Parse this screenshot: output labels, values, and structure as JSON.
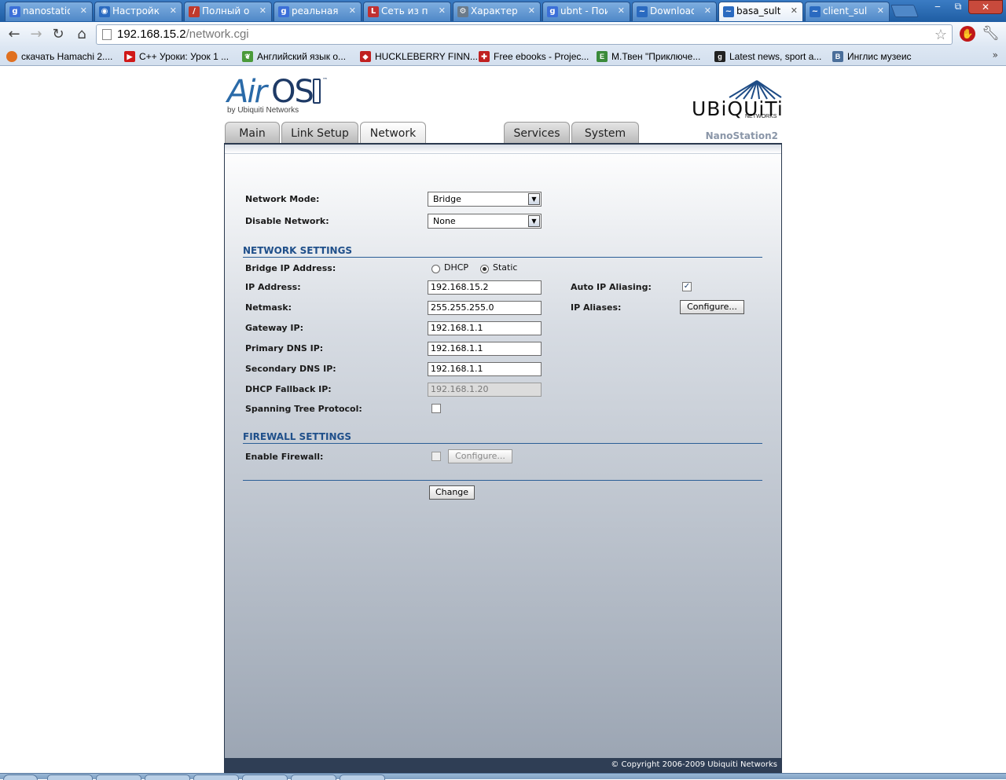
{
  "browser": {
    "tabs": [
      {
        "title": "nanostatio",
        "icon": "google-icon",
        "color": "#3b6fd8",
        "glyph": "g"
      },
      {
        "title": "Настройка",
        "icon": "globe-icon",
        "color": "#2a6ac0",
        "glyph": "◉"
      },
      {
        "title": "Полный о",
        "icon": "pen-icon",
        "color": "#c0392b",
        "glyph": "/"
      },
      {
        "title": "реальная",
        "icon": "google-icon",
        "color": "#3b6fd8",
        "glyph": "g"
      },
      {
        "title": "Сеть из па",
        "icon": "lan-icon",
        "color": "#c03030",
        "glyph": "L"
      },
      {
        "title": "Характери",
        "icon": "wrench-icon",
        "color": "#6a7a8a",
        "glyph": "⚙"
      },
      {
        "title": "ubnt - Пои",
        "icon": "google-icon",
        "color": "#3b6fd8",
        "glyph": "g"
      },
      {
        "title": "Download",
        "icon": "ubnt-icon",
        "color": "#2a6ac0",
        "glyph": "~"
      },
      {
        "title": "basa_sultar",
        "icon": "ubnt-icon",
        "color": "#2a6ac0",
        "glyph": "~"
      },
      {
        "title": "client_sulta",
        "icon": "ubnt-icon",
        "color": "#2a6ac0",
        "glyph": "~"
      }
    ],
    "window_controls": {
      "minimize": "‒",
      "maximize": "⧉",
      "close": "✕"
    },
    "nav": {
      "back": "←",
      "forward": "→",
      "reload": "↻",
      "home": "⌂"
    },
    "address": {
      "host": "192.168.15.2",
      "path": "/network.cgi"
    },
    "bookmarks": [
      {
        "label": "скачать Hamachi 2....",
        "icon": "firefox-icon",
        "color": "#e07020"
      },
      {
        "label": "C++ Уроки: Урок 1 ...",
        "icon": "youtube-icon",
        "color": "#d01818"
      },
      {
        "label": "Английский язык о...",
        "icon": "leaf-icon",
        "color": "#4a9a3a"
      },
      {
        "label": "HUCKLEBERRY FINN...",
        "icon": "diamond-icon",
        "color": "#c02020"
      },
      {
        "label": "Free ebooks - Projec...",
        "icon": "gutenberg-icon",
        "color": "#c02020"
      },
      {
        "label": "М.Твен \"Приключе...",
        "icon": "eng-icon",
        "color": "#3a8a3a"
      },
      {
        "label": "Latest news, sport a...",
        "icon": "g-icon",
        "color": "#222222"
      },
      {
        "label": "Инглис музеис",
        "icon": "vk-icon",
        "color": "#4a6e9a"
      }
    ],
    "bookmarks_more": "»"
  },
  "branding": {
    "air": "Air",
    "os": "OS",
    "tm": "™",
    "by": "by Ubiquiti Networks",
    "vendor": "UBiQUiTi",
    "vendor_sub": "NETWORKS",
    "device": "NanoStation2"
  },
  "nav_tabs": [
    "Main",
    "Link Setup",
    "Network",
    "Services",
    "System"
  ],
  "active_tab": "Network",
  "form": {
    "network_mode": {
      "label": "Network Mode:",
      "value": "Bridge"
    },
    "disable_network": {
      "label": "Disable Network:",
      "value": "None"
    },
    "network_settings_heading": "NETWORK SETTINGS",
    "bridge_ip": {
      "label": "Bridge IP Address:",
      "options": [
        "DHCP",
        "Static"
      ],
      "selected": "Static"
    },
    "ip_address": {
      "label": "IP Address:",
      "value": "192.168.15.2"
    },
    "netmask": {
      "label": "Netmask:",
      "value": "255.255.255.0"
    },
    "gateway": {
      "label": "Gateway IP:",
      "value": "192.168.1.1"
    },
    "primary_dns": {
      "label": "Primary DNS IP:",
      "value": "192.168.1.1"
    },
    "secondary_dns": {
      "label": "Secondary DNS IP:",
      "value": "192.168.1.1"
    },
    "dhcp_fallback": {
      "label": "DHCP Fallback IP:",
      "value": "192.168.1.20"
    },
    "stp": {
      "label": "Spanning Tree Protocol:",
      "checked": false
    },
    "auto_ip_aliasing": {
      "label": "Auto IP Aliasing:",
      "checked": true
    },
    "ip_aliases": {
      "label": "IP Aliases:",
      "button": "Configure..."
    },
    "firewall_settings_heading": "FIREWALL SETTINGS",
    "enable_firewall": {
      "label": "Enable Firewall:",
      "checked": false,
      "button": "Configure..."
    },
    "change_button": "Change"
  },
  "footer": "© Copyright 2006-2009 Ubiquiti Networks",
  "colors": {
    "accent": "#1f4f8a",
    "footer": "#2f3e55",
    "chrome": "#1f62a8"
  }
}
